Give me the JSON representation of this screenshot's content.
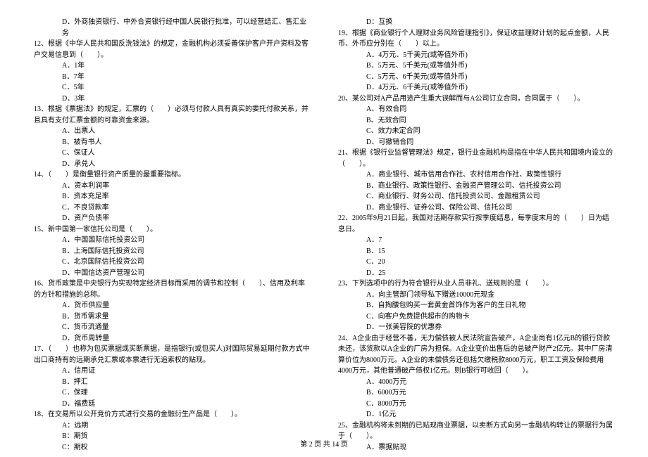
{
  "left": {
    "q11d": "D．外商独资银行、中外合资银行经中国人民银行批准，可以经营结汇、售汇业务",
    "q12": "12、根据《中华人民共和国反洗钱法》的规定，金融机构必须妥善保护客户开户资料及客户交易信息到（　　）。",
    "q12a": "A．1年",
    "q12b": "B．7年",
    "q12c": "C．5年",
    "q12d": "D．3年",
    "q13": "13、根据《票据法》的规定，汇票的（　　）必须与付款人具有真实的委托付款关系，并且具有支付汇票金额的可靠资金来源。",
    "q13a": "A、出票人",
    "q13b": "B、被背书人",
    "q13c": "C、保证人",
    "q13d": "D、承兑人",
    "q14": "14、（　　）是衡量银行资产质量的最重要指标。",
    "q14a": "A．资本利润率",
    "q14b": "B．资本充足率",
    "q14c": "C．不良贷款率",
    "q14d": "D．资产负债率",
    "q15": "15、新中国第一家信托公司是（　　）。",
    "q15a": "A．中国国际信托投资公司",
    "q15b": "B．上海国际信托投资公司",
    "q15c": "C．北京国际信托投资公司",
    "q15d": "D．中国信达资产管理公司",
    "q16": "16、货币政策是中央银行为实现特定经济目标而采用的调节和控制（　　）、信用及利率的方针和措施的总称。",
    "q16a": "A．货币供应量",
    "q16b": "B．货币需求量",
    "q16c": "C．货币流通量",
    "q16d": "D．货币周转量",
    "q17": "17、（　　）也称为包买票据或买断票据，是指银行(或包买人)对国际贸易延期付款方式中出口商持有的远期承兑汇票或本票进行无追索权的贴现。",
    "q17a": "A．信用证",
    "q17b": "B．押汇",
    "q17c": "C．保理",
    "q17d": "D．福费廷",
    "q18": "18、在交易所以公开竞价方式进行交易的金融衍生产品是（　　）。",
    "q18a": "A：远期",
    "q18b": "B：期货",
    "q18c": "C：期权"
  },
  "right": {
    "q18d": "D：互换",
    "q19": "19、根据《商业银行个人理财业务风险管理指引》，保证收益理财计划的起点金额，人民币、外币应分别在（　　）以上。",
    "q19a": "A．4万元、5千美元(或等值外币)",
    "q19b": "B．5万元、5千美元(或等值外币)",
    "q19c": "C．5万元、6千美元(或等值外币)",
    "q19d": "D．4万元、6千美元(或等值外币)",
    "q20": "20、某公司对A产品用途产生重大误解而与A公司订立合同，合同属于（　　）。",
    "q20a": "A、有效合同",
    "q20b": "B、无效合同",
    "q20c": "C、效力未定合同",
    "q20d": "D、可撤销合同",
    "q21": "21、根据《银行业监督管理法》规定，银行业金融机构是指在中华人民共和国境内设立的（　　）。",
    "q21a": "A．商业银行、城市信用合作社、农村信用合作社、政策性银行",
    "q21b": "B．商业银行、政策性银行、金融资产管理公司、信托投资公司",
    "q21c": "C．商业银行、财务公司、信托投资公司、金融租赁公司",
    "q21d": "D．商业银行、证券公司、保险公司、信托公司",
    "q22": "22、2005年9月21日起，我国对活期存款实行按季度结息，每季度末月的（　　）日为结息日。",
    "q22a": "A．7",
    "q22b": "B．15",
    "q22c": "C．20",
    "q22d": "D．25",
    "q23": "23、下列选项中的行为符合银行从业人员非礼、送规则的是（　　）。",
    "q23a": "A．向主管部门领导私下赠送10000元现金",
    "q23b": "B．自掏腰包购买一套黄金首饰作为客户的生日礼物",
    "q23c": "C．向客户免费提供超市的购物卡",
    "q23d": "D．一张美容院的优惠券",
    "q24": "24、A企业由于经营不善，无力偿债被人民法院宣告破产，A企业尚有1亿元B的银行贷款未还，该货款以A企业的厂房为担保。A企业变价出售后的总破产财产2亿元。其中厂房清算价位为8000万元。A企业的未偿债务还包括欠缴税款8000万元，职工工资及保险费用4000万元，其他普通破产债权1亿元。则B银行可收回（　　）。",
    "q24a": "A．4000万元",
    "q24b": "B．6000万元",
    "q24c": "C．8000万元",
    "q24d": "D．1亿元",
    "q25": "25、金融机构将未到期的已贴现商业票据，以卖断方式向另一金融机构转让的票据行为属于（　　）。",
    "q25a": "A．票据贴现"
  },
  "footer": "第 2 页 共 14 页"
}
